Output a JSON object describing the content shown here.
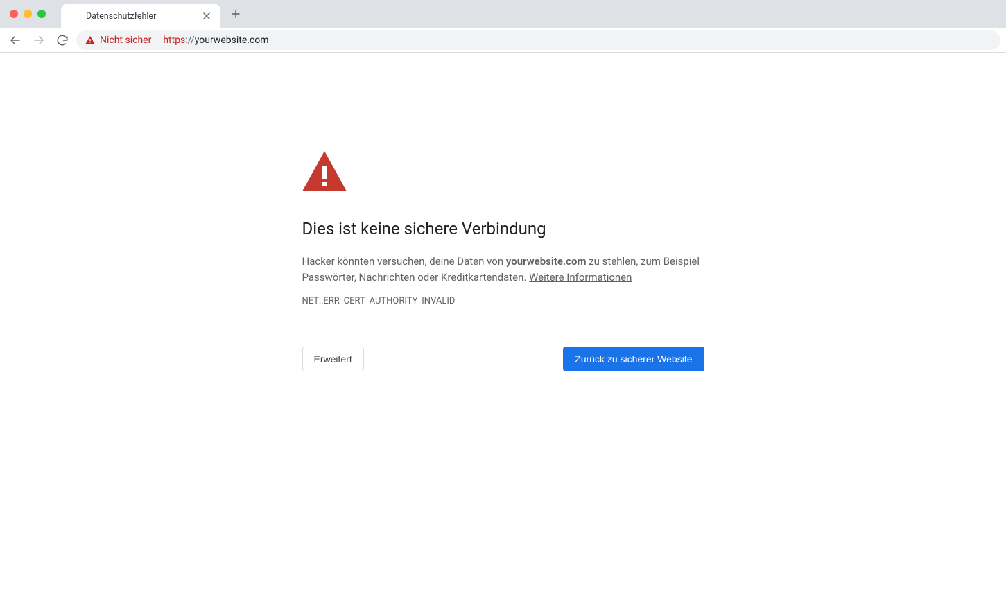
{
  "tab": {
    "title": "Datenschutzfehler"
  },
  "addressbar": {
    "security_label": "Nicht sicher",
    "scheme": "https",
    "separator": "://",
    "host": "yourwebsite.com"
  },
  "interstitial": {
    "heading": "Dies ist keine sichere Verbindung",
    "desc_pre": "Hacker könnten versuchen, deine Daten von ",
    "desc_site": "yourwebsite.com",
    "desc_post": " zu stehlen, zum Beispiel Passwörter, Nachrichten oder Kreditkartendaten. ",
    "learn_more": "Weitere Informationen",
    "error_code": "NET::ERR_CERT_AUTHORITY_INVALID",
    "advanced_button": "Erweitert",
    "back_button": "Zurück zu sicherer Website"
  },
  "colors": {
    "danger": "#c5221f",
    "primary": "#1a73e8"
  }
}
